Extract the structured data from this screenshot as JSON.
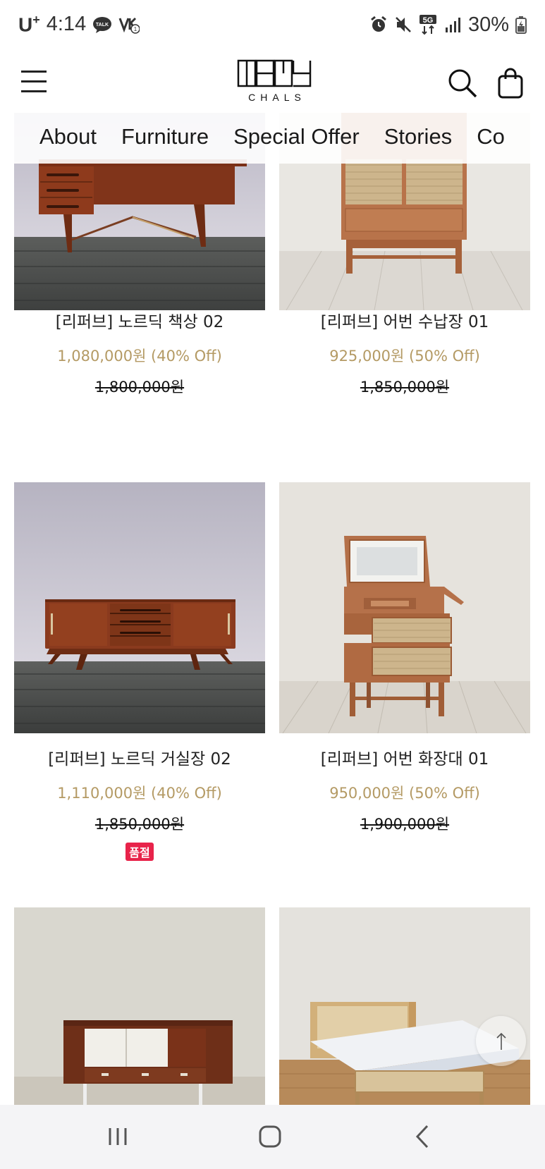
{
  "status_bar": {
    "carrier": "U",
    "carrier_sup": "+",
    "time": "4:14",
    "battery": "30%",
    "icons": [
      "talk-icon",
      "volte-icon",
      "alarm-icon",
      "mute-icon",
      "5g-icon",
      "signal-icon",
      "battery-icon"
    ]
  },
  "header": {
    "logo_text": "CHALS",
    "nav": [
      "About",
      "Furniture",
      "Special Offer",
      "Stories",
      "Co"
    ]
  },
  "products": [
    {
      "name": "[리퍼브] 노르딕 책상 02",
      "sale": "1,080,000원 (40% Off)",
      "original": "1,800,000원",
      "badge": ""
    },
    {
      "name": "[리퍼브] 어번 수납장 01",
      "sale": "925,000원 (50% Off)",
      "original": "1,850,000원",
      "badge": ""
    },
    {
      "name": "[리퍼브] 노르딕 거실장 02",
      "sale": "1,110,000원 (40% Off)",
      "original": "1,850,000원",
      "badge": "품절"
    },
    {
      "name": "[리퍼브] 어번 화장대 01",
      "sale": "950,000원 (50% Off)",
      "original": "1,900,000원",
      "badge": ""
    }
  ],
  "colors": {
    "accent_price": "#b49a64",
    "soldout_badge": "#e8234a",
    "teak": "#8a3a1e",
    "cherry": "#b8734a",
    "rattan": "#d9c9a8"
  }
}
